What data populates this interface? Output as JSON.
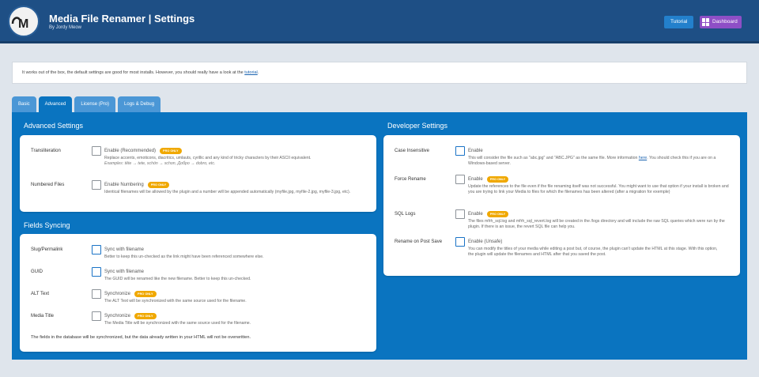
{
  "header": {
    "title": "Media File Renamer | Settings",
    "subtitle": "By Jordy Meow",
    "logo_letter": "M",
    "tutorial_label": "Tutorial",
    "dashboard_label": "Dashboard"
  },
  "notice": {
    "text": "It works out of the box, the default settings are good for most installs. However, you should really have a look at the ",
    "link": "tutorial",
    "end": "."
  },
  "tabs": [
    {
      "label": "Basic",
      "active": false
    },
    {
      "label": "Advanced",
      "active": true
    },
    {
      "label": "License (Pro)",
      "active": false
    },
    {
      "label": "Logs & Debug",
      "active": false
    }
  ],
  "advanced": {
    "title": "Advanced Settings",
    "rows": [
      {
        "label": "Transliteration",
        "option": "Enable (Recommended)",
        "badge": "PRO ONLY",
        "desc": "Replace accents, emoticons, diacritics, umlauts, cyrillic and any kind of tricky characters by their ASCII equivalent.",
        "example": "Examples: tête → tete, schön → schon, Добро → dobro, etc."
      },
      {
        "label": "Numbered Files",
        "option": "Enable Numbering",
        "badge": "PRO ONLY",
        "desc": "Identical filenames will be allowed by the plugin and a number will be appended automatically (myfile.jpg, myfile-2.jpg, myfile-3.jpg, etc)."
      }
    ]
  },
  "syncing": {
    "title": "Fields Syncing",
    "rows": [
      {
        "label": "Slug/Permalink",
        "option": "Sync with filename",
        "desc": "Better to keep this un-checked as the link might have been referenced somewhere else."
      },
      {
        "label": "GUID",
        "option": "Sync with filename",
        "desc": "The GUID will be renamed like the new filename. Better to keep this un-checked."
      },
      {
        "label": "ALT Text",
        "option": "Synchronize",
        "badge": "PRO ONLY",
        "desc": "The ALT Text will be synchronized with the same source used for the filename."
      },
      {
        "label": "Media Title",
        "option": "Synchronize",
        "badge": "PRO ONLY",
        "desc": "The Media Title will be synchronized with the same source used for the filename."
      }
    ],
    "footnote": "The fields in the database will be synchronized, but the data already written in your HTML will not be overwritten."
  },
  "developer": {
    "title": "Developer Settings",
    "rows": [
      {
        "label": "Case Insensitive",
        "option": "Enable",
        "desc": "This will consider the file such as \"abc.jpg\" and \"ABC.JPG\" as the same file. More information ",
        "link": "here",
        "desc_end": ". You should check this if you are on a Windows-based server."
      },
      {
        "label": "Force Rename",
        "option": "Enable",
        "badge": "PRO ONLY",
        "desc": "Update the references to the file even if the file renaming itself was not successful. You might want to use that option if your install is broken and you are trying to link your Media to files for which the filenames has been altered (after a migration for exemple)"
      },
      {
        "label": "SQL Logs",
        "option": "Enable",
        "badge": "PRO ONLY",
        "desc": "The files mfrh_sql.log and mfrh_sql_revert.log will be created in the /logs directory and will include the raw SQL queries which were run by the plugin. If there is an issue, the revert SQL file can help you."
      },
      {
        "label": "Rename on Post Save",
        "option": "Enable (Unsafe)",
        "desc": "You can modify the titles of your media while editing a post but, of course, the plugin can't update the HTML at this stage. With this option, the plugin will update the filenames and HTML after that you saved the post."
      }
    ]
  }
}
